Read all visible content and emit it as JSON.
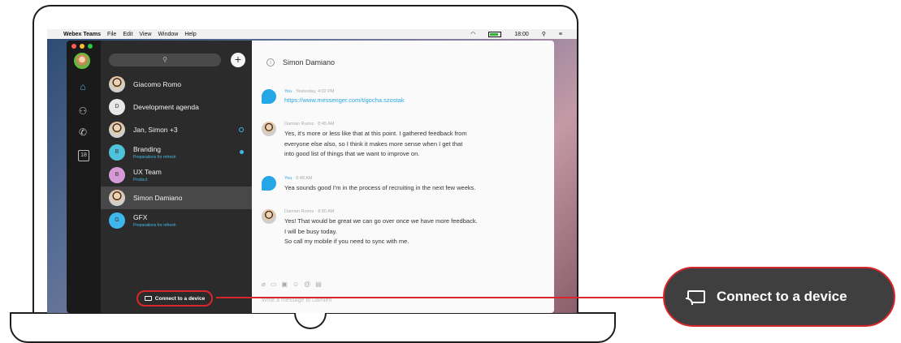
{
  "menubar": {
    "app_name": "Webex Teams",
    "menus": [
      "File",
      "Edit",
      "View",
      "Window",
      "Help"
    ],
    "clock": "18:00"
  },
  "search": {
    "icon": "search-icon"
  },
  "rail": {
    "calendar_day": "18"
  },
  "conversations": [
    {
      "name": "Giacomo Romo",
      "subtitle": "",
      "avatar": "photo"
    },
    {
      "name": "Development agenda",
      "subtitle": "",
      "avatar": "D",
      "color": "#e8e8e8"
    },
    {
      "name": "Jan, Simon +3",
      "subtitle": "",
      "avatar": "photo"
    },
    {
      "name": "Branding",
      "subtitle": "Preparations for refresh",
      "avatar": "B",
      "color": "#4fc3d9"
    },
    {
      "name": "UX Team",
      "subtitle": "Product",
      "avatar": "B",
      "color": "#d69ad6"
    },
    {
      "name": "Simon Damiano",
      "subtitle": "",
      "avatar": "photo"
    },
    {
      "name": "GFX",
      "subtitle": "Preparations for refresh",
      "avatar": "G",
      "color": "#3fb6ec"
    }
  ],
  "connect_small": "Connect to a device",
  "chat": {
    "title": "Simon Damiano",
    "messages": [
      {
        "sender": "You",
        "time": "Yesterday, 4:02 PM",
        "lines": [],
        "link": "https://www.messenger.com/t/gocha.szostak"
      },
      {
        "sender": "Damian Ruirez",
        "time": "8:45 AM",
        "lines": [
          "Yes, it's more or less like that at this point. I gathered feedback from",
          "everyone else also, so I think it makes more sense when I get that",
          "into good list of things that we want to improve on."
        ]
      },
      {
        "sender": "You",
        "time": "8:48 AM",
        "lines": [
          "Yea sounds good I'm in the process of recruiting in the next few weeks."
        ]
      },
      {
        "sender": "Damian Ruirez",
        "time": "8:50 AM",
        "lines": [
          "Yes! That would be great we can go over once we have more feedback.",
          "I will be busy today.",
          "So call my mobile if you need to sync with me."
        ]
      }
    ],
    "composer_placeholder": "Write a message to Damien"
  },
  "callout": {
    "label": "Connect to a device",
    "icon": "cast-icon",
    "accent": "#d9262a"
  }
}
